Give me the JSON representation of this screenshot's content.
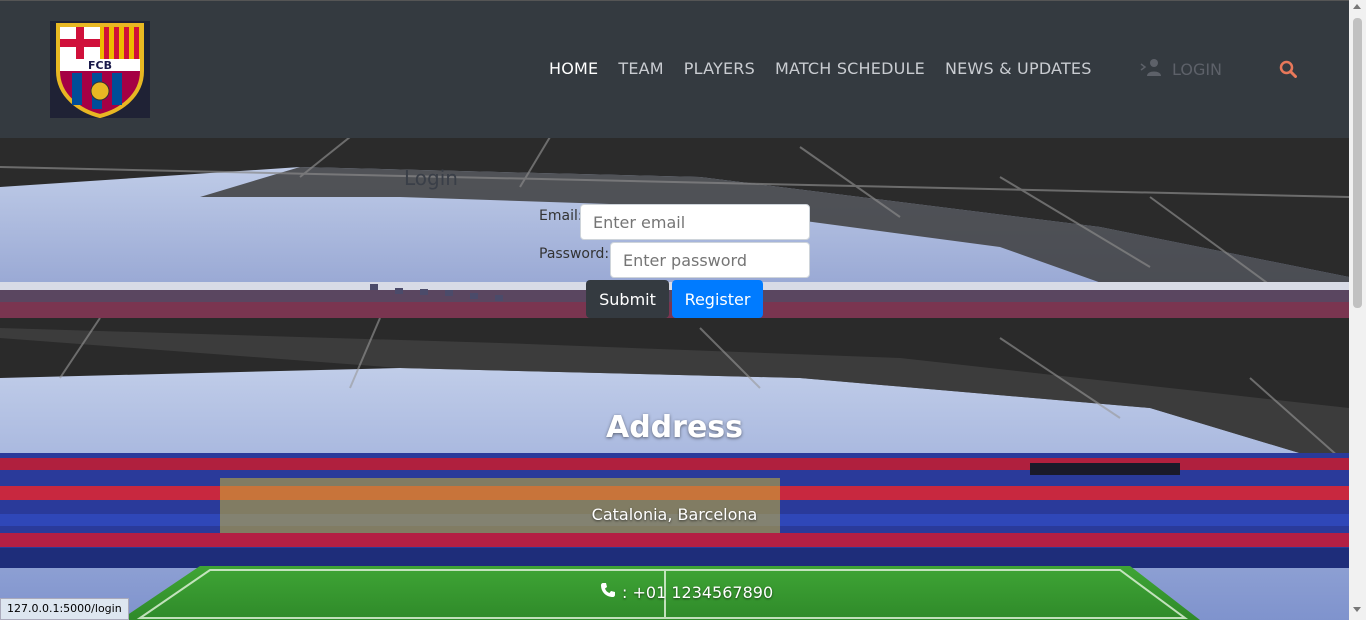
{
  "nav": {
    "items": [
      {
        "label": "HOME",
        "active": true
      },
      {
        "label": "TEAM"
      },
      {
        "label": "PLAYERS"
      },
      {
        "label": "MATCH SCHEDULE"
      },
      {
        "label": "NEWS & UPDATES"
      }
    ],
    "login_label": "LOGIN"
  },
  "logo": {
    "text": "FCB"
  },
  "login": {
    "title": "Login",
    "email_label": "Email:",
    "email_placeholder": "Enter email",
    "password_label": "Password:",
    "password_placeholder": "Enter password",
    "submit_label": "Submit",
    "register_label": "Register"
  },
  "address": {
    "title": "Address",
    "location": "Catalonia, Barcelona",
    "phone": ": +01 1234567890"
  },
  "status_bar": {
    "url": "127.0.0.1:5000/login"
  },
  "colors": {
    "header": "#343a40",
    "register_button": "#007bff",
    "submit_button": "#343a40",
    "search_icon": "#e8785a"
  }
}
